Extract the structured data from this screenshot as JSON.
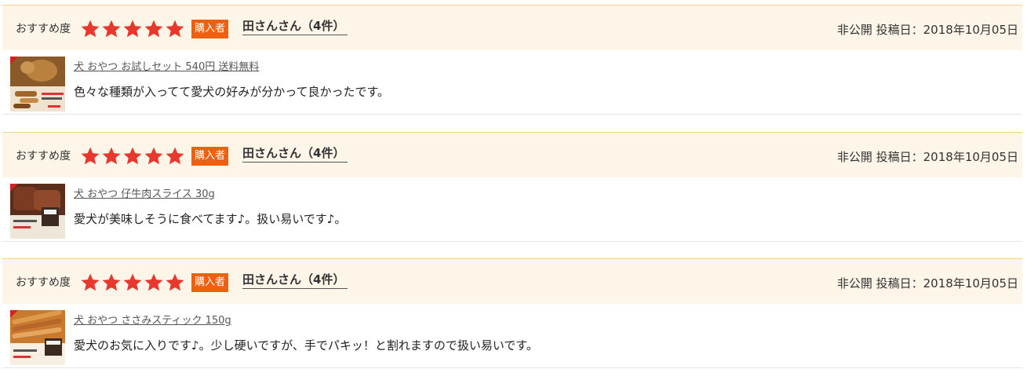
{
  "reviews": [
    {
      "rec_label": "おすすめ度",
      "rating": 5,
      "badge": "購入者",
      "author": "田さんさん（4件）",
      "meta": "非公開 投稿日：2018年10月05日",
      "product": "犬 おやつ お試しセット 540円 送料無料",
      "comment": "色々な種類が入ってて愛犬の好みが分かって良かったです。",
      "thumb_icon": "product-thumbnail-dog-treat-set"
    },
    {
      "rec_label": "おすすめ度",
      "rating": 5,
      "badge": "購入者",
      "author": "田さんさん（4件）",
      "meta": "非公開 投稿日：2018年10月05日",
      "product": "犬 おやつ 仔牛肉スライス 30g",
      "comment": "愛犬が美味しそうに食べてます♪。扱い易いです♪。",
      "thumb_icon": "product-thumbnail-veal-slice"
    },
    {
      "rec_label": "おすすめ度",
      "rating": 5,
      "badge": "購入者",
      "author": "田さんさん（4件）",
      "meta": "非公開 投稿日：2018年10月05日",
      "product": "犬 おやつ ささみスティック 150g",
      "comment": "愛犬のお気に入りです♪。少し硬いですが、手でパキッ！と割れますので扱い易いです。",
      "thumb_icon": "product-thumbnail-chicken-stick"
    }
  ],
  "colors": {
    "header_bg": "#fdf5e8",
    "header_border": "#f3d189",
    "star": "#e8382e",
    "badge_bg": "#ee6010"
  }
}
